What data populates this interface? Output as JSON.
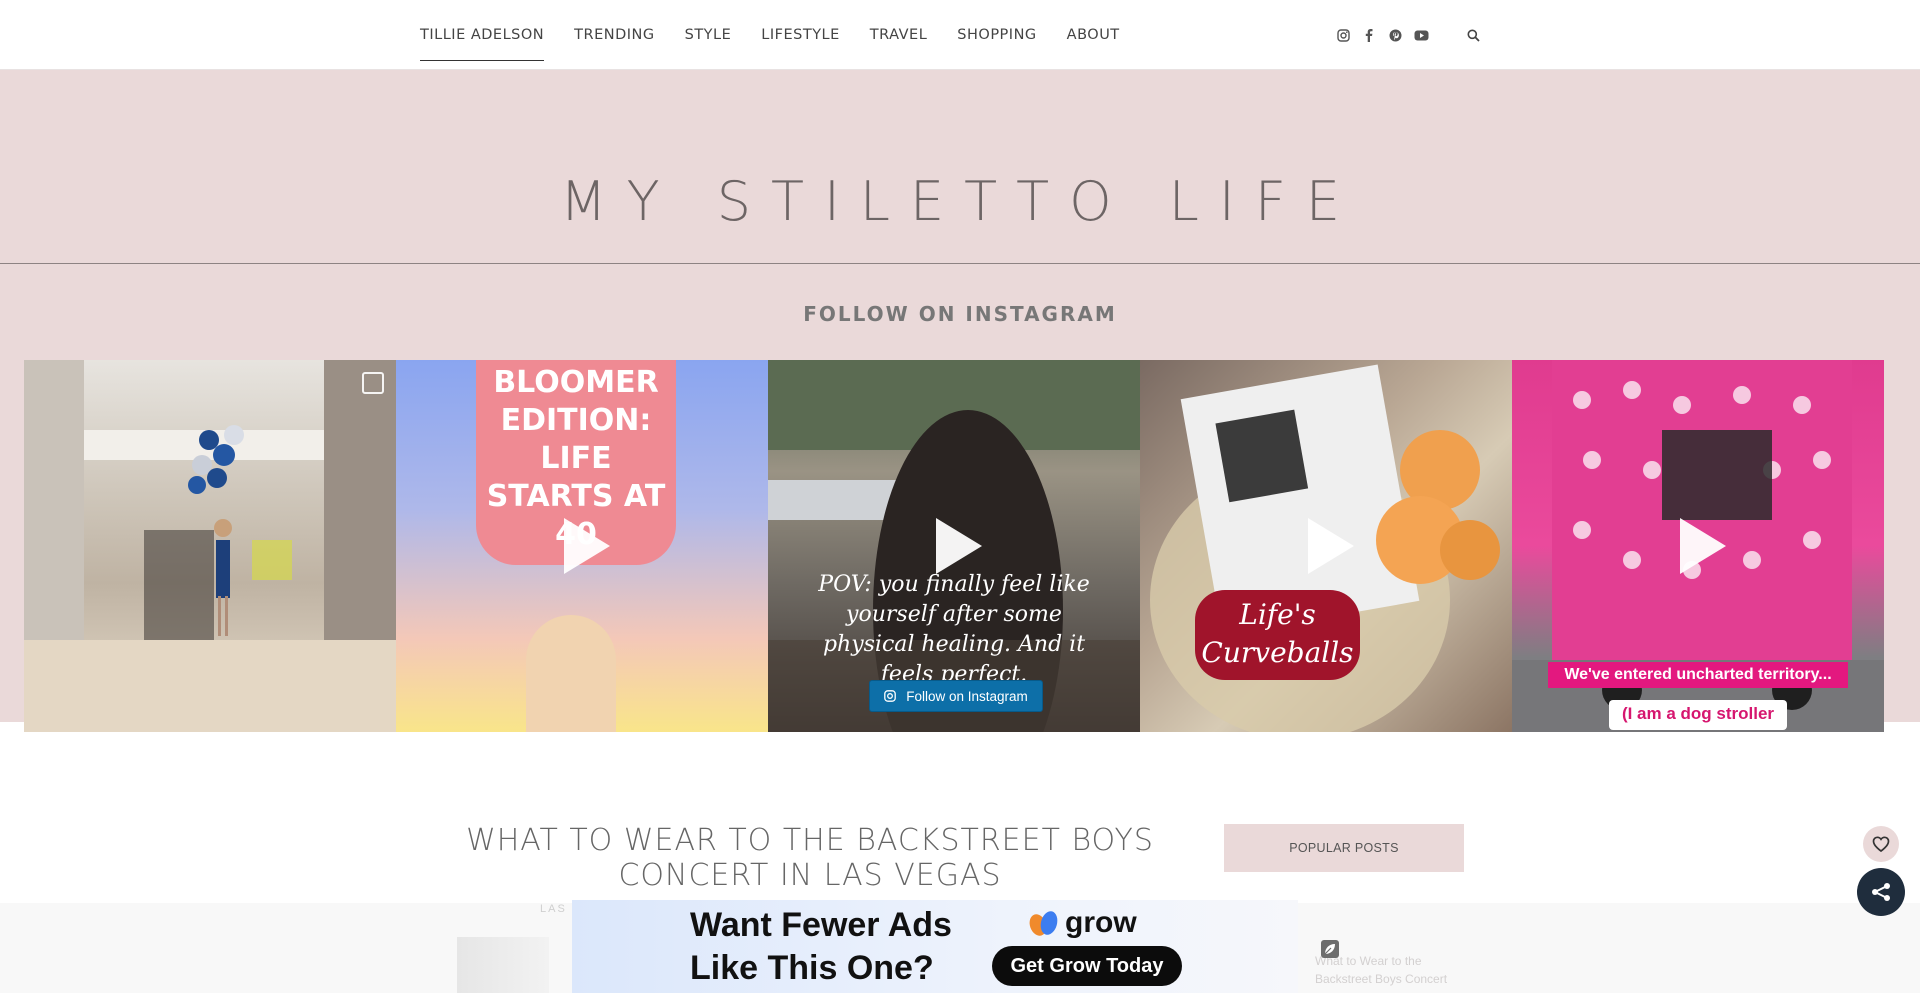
{
  "nav": {
    "items": [
      {
        "label": "TILLIE ADELSON"
      },
      {
        "label": "TRENDING"
      },
      {
        "label": "STYLE"
      },
      {
        "label": "LIFESTYLE"
      },
      {
        "label": "TRAVEL"
      },
      {
        "label": "SHOPPING"
      },
      {
        "label": "ABOUT"
      }
    ],
    "social_icons": [
      "instagram-icon",
      "facebook-icon",
      "pinterest-icon",
      "youtube-icon"
    ],
    "search_icon": "search-icon"
  },
  "header": {
    "site_title": "MY STILETTO LIFE",
    "follow_heading": "FOLLOW ON INSTAGRAM"
  },
  "instagram": {
    "tiles": [
      {
        "caption": ""
      },
      {
        "caption": "BLOOMER EDITION: LIFE STARTS AT 40"
      },
      {
        "caption": "POV: you finally feel like yourself after some physical healing. And it feels perfect."
      },
      {
        "caption": "Life's Curveballs"
      },
      {
        "caption_top": "We've entered uncharted territory...",
        "caption_bottom": "(I am a dog stroller"
      }
    ],
    "follow_button": "Follow on Instagram"
  },
  "main": {
    "post_title": "WHAT TO WEAR TO THE BACKSTREET BOYS CONCERT IN LAS VEGAS",
    "faded_category": "LAS"
  },
  "sidebar": {
    "popular_label": "POPULAR POSTS",
    "faded_excerpt": "What to Wear to the Backstreet Boys Concert"
  },
  "ad": {
    "line1": "Want Fewer Ads",
    "line2": "Like This One?",
    "brand": "grow",
    "cta": "Get Grow Today"
  },
  "colors": {
    "band": "#ead9d9",
    "accent_button": "#0d6fa8",
    "share_button": "#1f2d3d"
  }
}
